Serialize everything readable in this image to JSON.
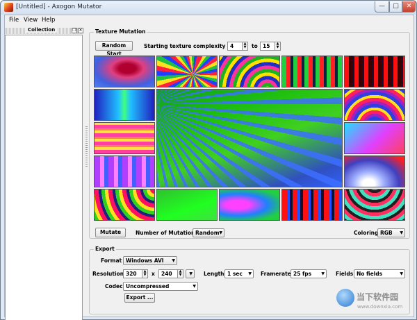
{
  "window": {
    "title": "[Untitled] - Axogon Mutator",
    "controls": {
      "minimize": "—",
      "maximize": "□",
      "close": "✕"
    }
  },
  "menu": [
    "File",
    "View",
    "Help"
  ],
  "collection": {
    "title": "Collection",
    "float_glyph": "❐",
    "close_glyph": "✕"
  },
  "texture_mutation": {
    "title": "Texture Mutation",
    "random_start": "Random Start",
    "complexity_label": "Starting texture complexity from",
    "from_value": "4",
    "to_label": "to",
    "to_value": "15",
    "mutate": "Mutate",
    "mutations_label": "Number of Mutations",
    "mutations_value": "Random",
    "coloring_label": "Coloring",
    "coloring_value": "RGB"
  },
  "export": {
    "title": "Export",
    "format_label": "Format",
    "format_value": "Windows AVI",
    "resolution_label": "Resolution",
    "res_width": "320",
    "x_label": "x",
    "res_height": "240",
    "length_label": "Length",
    "length_value": "1 sec",
    "framerate_label": "Framerate",
    "framerate_value": "25 fps",
    "fields_label": "Fields",
    "fields_value": "No fields",
    "codec_label": "Codec",
    "codec_value": "Uncompressed",
    "export_button": "Export ..."
  },
  "watermark": {
    "text": "当下软件园",
    "url": "www.downxia.com"
  },
  "tiles": [
    {
      "name": "tile-1",
      "css": "radial-gradient(ellipse at 55% 40%,#b00030 0 18%,#e04080 35%,#4060e0 70%,#5080f0)"
    },
    {
      "name": "tile-2",
      "css": "repeating-conic-gradient(from 20deg at 60% 60%,#ff2040 0 8deg,#ffe020 8deg 16deg,#20c040 16deg 24deg,#2040ff 24deg 32deg)"
    },
    {
      "name": "tile-3",
      "css": "repeating-radial-gradient(circle at 80% 110%,#ffe000 0 5px,#20b020 5px 10px,#ff30a0 10px 15px,#2030c0 15px 20px)"
    },
    {
      "name": "tile-4",
      "css": "repeating-linear-gradient(90deg,#20d040 0 6px,#ff2020 6px 12px,#102040 12px 16px)"
    },
    {
      "name": "tile-5",
      "css": "repeating-linear-gradient(90deg,#ff1010 0 6px,#3a0000 6px 11px,#101030 11px 14px)"
    },
    {
      "name": "tile-6",
      "css": "linear-gradient(90deg,#2020c0,#20c0ff 40%,#40ff80 50%,#20c0ff 60%,#2020c0)"
    },
    {
      "name": "tile-7",
      "css": "repeating-linear-gradient(0deg,#ff40a0 0 5px,#ffe040 5px 9px,#ff8060 9px 12px)"
    },
    {
      "name": "tile-8",
      "css": "repeating-linear-gradient(90deg,#b040ff 0 8px,#ff80ff 8px 14px,#4060ff 14px 20px)"
    },
    {
      "name": "tile-9",
      "css": "repeating-radial-gradient(circle at 100% 0%,#ff1060 0 6px,#ffe020 6px 11px,#30d020 11px 16px,#202080 16px 20px)"
    },
    {
      "name": "tile-10",
      "css": "linear-gradient(160deg,#30c030,#20ff20 60%,#40e040)"
    },
    {
      "name": "tile-11",
      "css": "radial-gradient(ellipse at 30% 50%,#ff40ff 0 20%,#2080ff 50%,#20d040 80%)"
    },
    {
      "name": "tile-12",
      "css": "repeating-linear-gradient(90deg,#ff1010 0 7px,#2050ff 7px 11px,#101030 11px 15px)"
    },
    {
      "name": "tile-13",
      "css": "repeating-radial-gradient(circle at 50% 120%,#ff2060 0 5px,#ffe020 5px 9px,#3040e0 9px 14px,#a020c0 14px 18px)"
    },
    {
      "name": "tile-14",
      "css": "linear-gradient(135deg,#20e0ff,#e040ff 55%,#ff4060)"
    },
    {
      "name": "tile-15",
      "css": "radial-gradient(ellipse at 40% 90%,#ffffff 0 12%,#a0b0ff 30%,#4040c0 60%,#ff2020 90%)"
    },
    {
      "name": "tile-16",
      "css": "repeating-radial-gradient(circle at 50% -20%,#ff3060 0 5px,#40e0c0 5px 10px,#202020 10px 14px)"
    }
  ]
}
